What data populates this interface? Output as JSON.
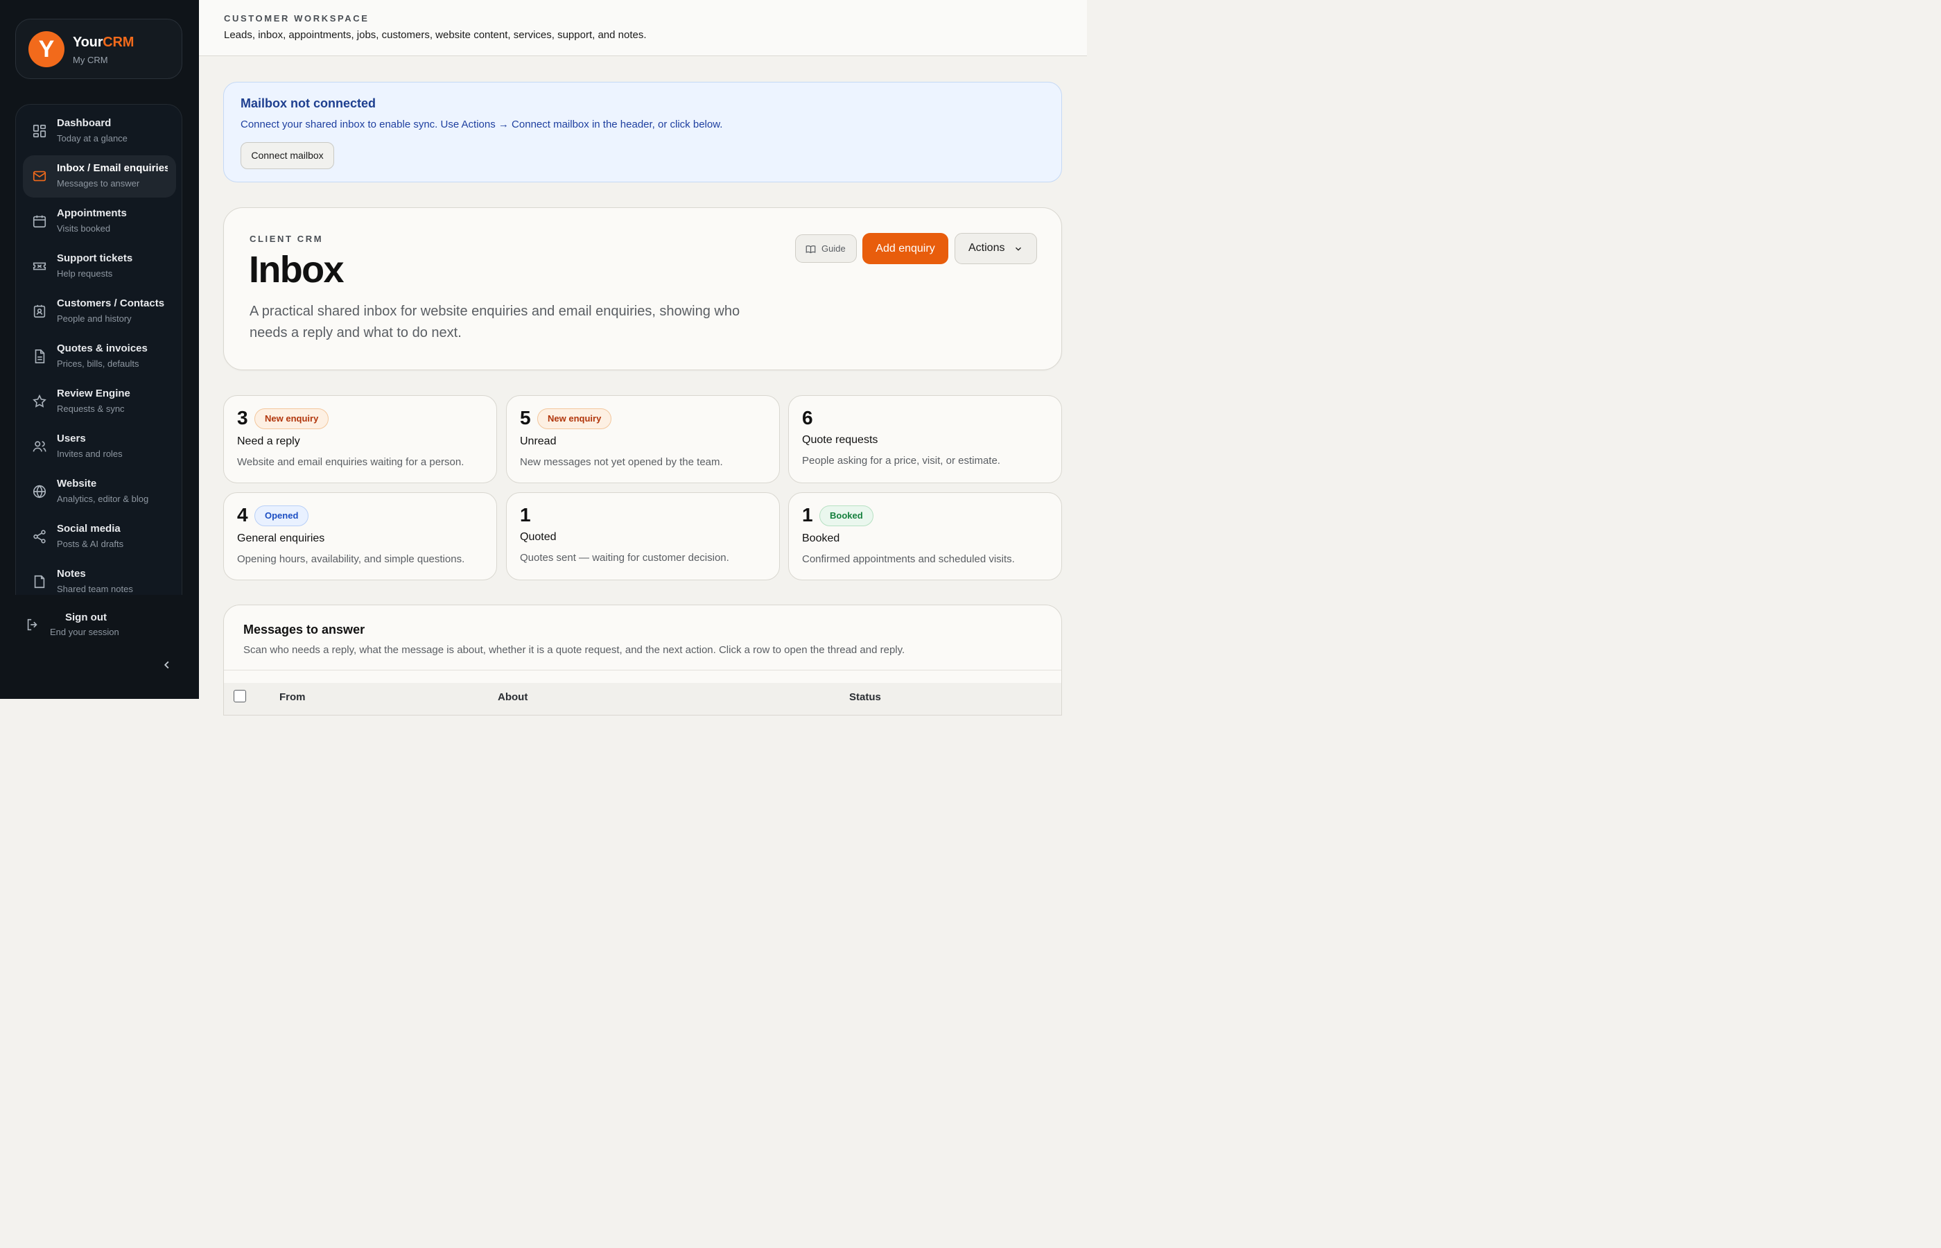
{
  "brand": {
    "logo_letter": "Y",
    "name_plain": "Your",
    "name_accent": "CRM",
    "subtitle": "My CRM",
    "accent_color": "#f26a1b"
  },
  "nav": {
    "items": [
      {
        "title": "Dashboard",
        "subtitle": "Today at a glance",
        "icon": "dashboard-icon",
        "active": false
      },
      {
        "title": "Inbox / Email enquiries",
        "subtitle": "Messages to answer",
        "icon": "mail-icon",
        "active": true
      },
      {
        "title": "Appointments",
        "subtitle": "Visits booked",
        "icon": "calendar-icon",
        "active": false
      },
      {
        "title": "Support tickets",
        "subtitle": "Help requests",
        "icon": "ticket-icon",
        "active": false
      },
      {
        "title": "Customers / Contacts",
        "subtitle": "People and history",
        "icon": "contact-icon",
        "active": false
      },
      {
        "title": "Quotes & invoices",
        "subtitle": "Prices, bills, defaults",
        "icon": "document-icon",
        "active": false
      },
      {
        "title": "Review Engine",
        "subtitle": "Requests & sync",
        "icon": "star-icon",
        "active": false
      },
      {
        "title": "Users",
        "subtitle": "Invites and roles",
        "icon": "users-icon",
        "active": false
      },
      {
        "title": "Website",
        "subtitle": "Analytics, editor & blog",
        "icon": "globe-icon",
        "active": false
      },
      {
        "title": "Social media",
        "subtitle": "Posts & AI drafts",
        "icon": "share-icon",
        "active": false
      },
      {
        "title": "Notes",
        "subtitle": "Shared team notes",
        "icon": "note-icon",
        "active": false
      }
    ],
    "signout": {
      "title": "Sign out",
      "subtitle": "End your session",
      "icon": "logout-icon"
    },
    "collapse_icon": "chevron-left-icon"
  },
  "header": {
    "eyebrow": "CUSTOMER WORKSPACE",
    "description": "Leads, inbox, appointments, jobs, customers, website content, services, support, and notes."
  },
  "alert": {
    "title": "Mailbox not connected",
    "text": "Connect your shared inbox to enable sync. Use Actions → Connect mailbox in the header, or click below.",
    "button": "Connect mailbox"
  },
  "hero": {
    "eyebrow": "CLIENT CRM",
    "title": "Inbox",
    "description": "A practical shared inbox for website enquiries and email enquiries, showing who needs a reply and what to do next.",
    "guide_button": "Guide",
    "add_button": "Add enquiry",
    "actions_button": "Actions",
    "primary_color": "#e85d0c"
  },
  "stats": [
    {
      "number": "3",
      "badge": "New enquiry",
      "badge_kind": "new",
      "label": "Need a reply",
      "description": "Website and email enquiries waiting for a person."
    },
    {
      "number": "5",
      "badge": "New enquiry",
      "badge_kind": "new",
      "label": "Unread",
      "description": "New messages not yet opened by the team."
    },
    {
      "number": "6",
      "badge": "",
      "badge_kind": "",
      "label": "Quote requests",
      "description": "People asking for a price, visit, or estimate."
    },
    {
      "number": "4",
      "badge": "Opened",
      "badge_kind": "opened",
      "label": "General enquiries",
      "description": "Opening hours, availability, and simple questions."
    },
    {
      "number": "1",
      "badge": "",
      "badge_kind": "",
      "label": "Quoted",
      "description": "Quotes sent — waiting for customer decision."
    },
    {
      "number": "1",
      "badge": "Booked",
      "badge_kind": "booked",
      "label": "Booked",
      "description": "Confirmed appointments and scheduled visits."
    }
  ],
  "messages": {
    "title": "Messages to answer",
    "description": "Scan who needs a reply, what the message is about, whether it is a quote request, and the next action. Click a row to open the thread and reply.",
    "columns": [
      "From",
      "About",
      "Status"
    ]
  }
}
